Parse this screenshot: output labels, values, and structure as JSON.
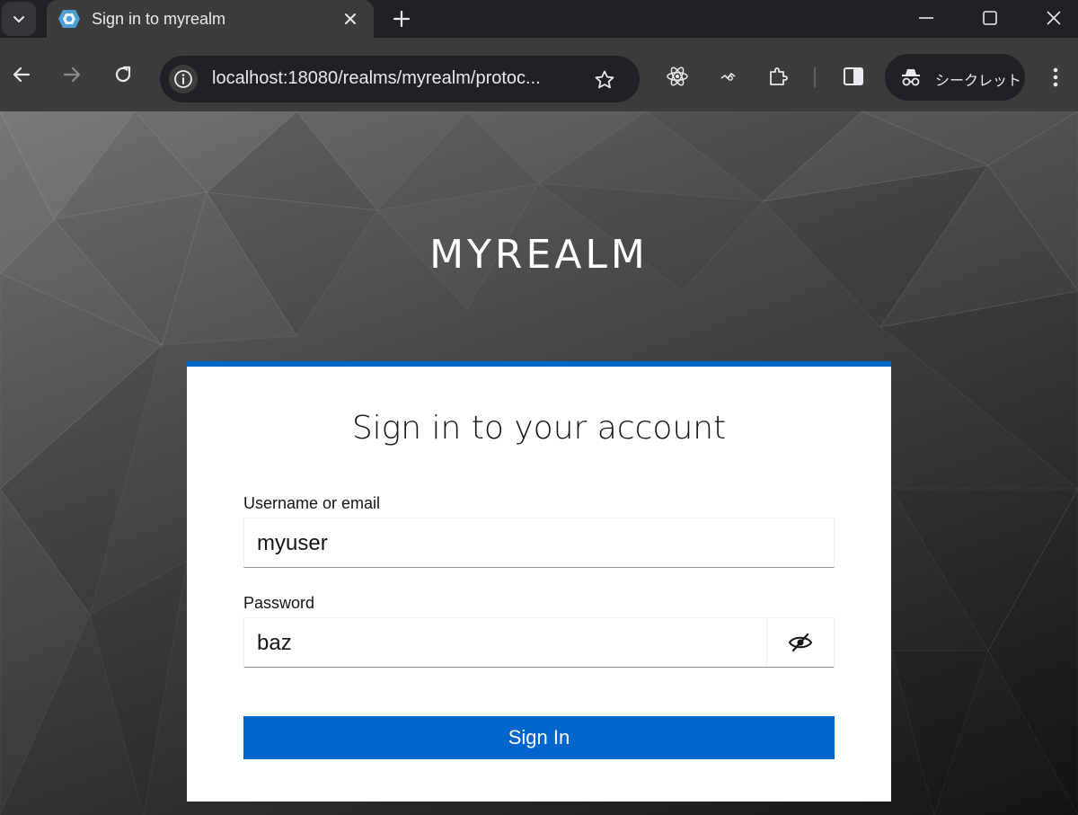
{
  "browser": {
    "tab_title": "Sign in to myrealm",
    "address": "localhost:18080/realms/myrealm/protoc...",
    "incognito_label": "シークレット",
    "icons": [
      "tab-search-icon",
      "close-icon",
      "plus-icon",
      "minimize-icon",
      "maximize-icon",
      "window-close-icon",
      "back-icon",
      "forward-icon",
      "reload-icon",
      "info-icon",
      "star-icon",
      "react-devtools-icon",
      "extension-icon",
      "puzzle-icon",
      "side-panel-icon",
      "incognito-icon",
      "kebab-menu-icon"
    ]
  },
  "page": {
    "realm_title": "MYREALM",
    "card_title": "Sign in to your account",
    "username": {
      "label": "Username or email",
      "value": "myuser"
    },
    "password": {
      "label": "Password",
      "value": "baz"
    },
    "signin_label": "Sign In"
  },
  "colors": {
    "accent": "#0066cc",
    "chrome_dark": "#202124",
    "chrome_toolbar": "#3c3c3c"
  }
}
